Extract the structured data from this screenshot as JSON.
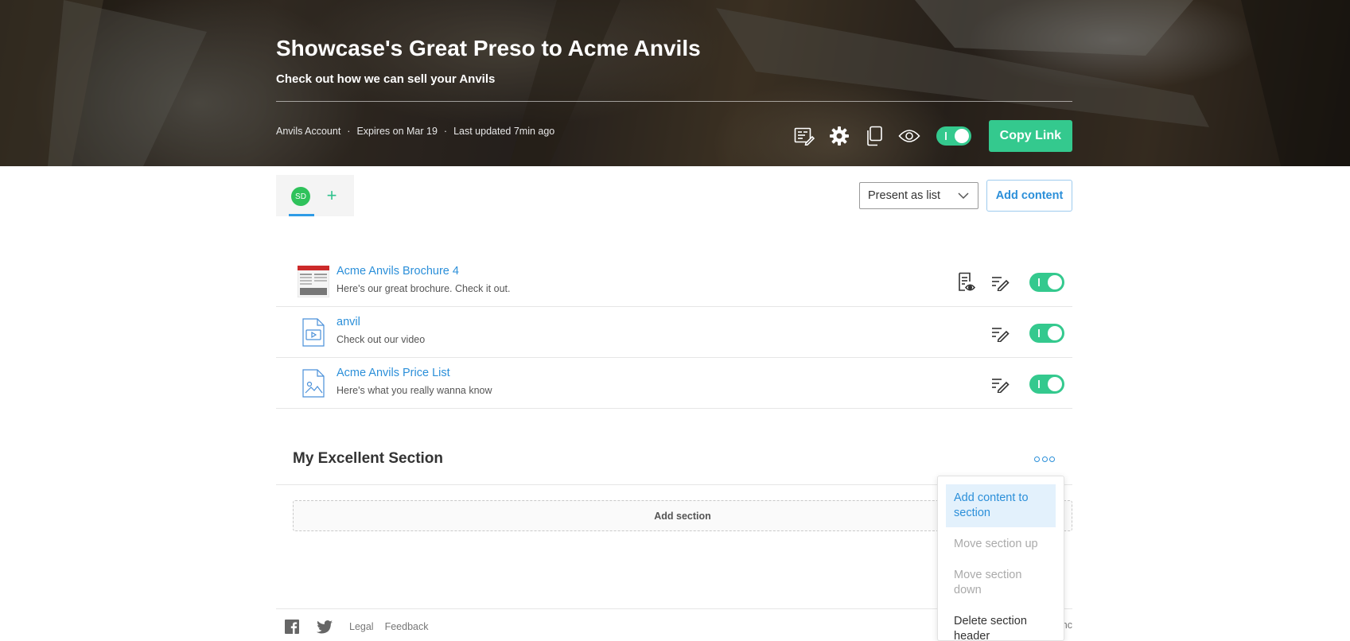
{
  "hero": {
    "title": "Showcase's Great Preso to Acme Anvils",
    "subtitle": "Check out how we can sell your Anvils",
    "meta": {
      "account": "Anvils Account",
      "separator": "·",
      "expires": "Expires on Mar 19",
      "updated": "Last updated 7min ago"
    },
    "actions": {
      "icons": [
        "edit-details-icon",
        "gear-icon",
        "copy-icon",
        "eye-icon"
      ],
      "toggle_on": true,
      "copy_link_label": "Copy Link"
    }
  },
  "toolbar": {
    "avatar_initials": "SD",
    "add_user_symbol": "+",
    "present_select_value": "Present as list",
    "add_content_label": "Add content"
  },
  "content_items": [
    {
      "title": "Acme Anvils Brochure 4",
      "description": "Here's our great brochure. Check it out.",
      "thumb": "brochure-thumbnail",
      "icons": [
        "preview-doc-icon",
        "edit-icon"
      ],
      "enabled": true
    },
    {
      "title": "anvil",
      "description": "Check out our video",
      "thumb": "video-file-icon",
      "icons": [
        "edit-icon"
      ],
      "enabled": true
    },
    {
      "title": "Acme Anvils Price List",
      "description": "Here's what you really wanna know",
      "thumb": "image-file-icon",
      "icons": [
        "edit-icon"
      ],
      "enabled": true
    }
  ],
  "section": {
    "title": "My Excellent Section",
    "add_section_label": "Add section"
  },
  "menu": {
    "items": [
      {
        "label": "Add content to section",
        "state": "active"
      },
      {
        "label": "Move section up",
        "state": "disabled"
      },
      {
        "label": "Move section down",
        "state": "disabled"
      },
      {
        "label": "Delete section header",
        "state": "normal"
      }
    ]
  },
  "footer": {
    "legal": "Legal",
    "feedback": "Feedback",
    "right_text": "nc"
  },
  "colors": {
    "accent_green": "#34c98e",
    "link_blue": "#2b8fd9",
    "avatar_green": "#2fc25b"
  }
}
